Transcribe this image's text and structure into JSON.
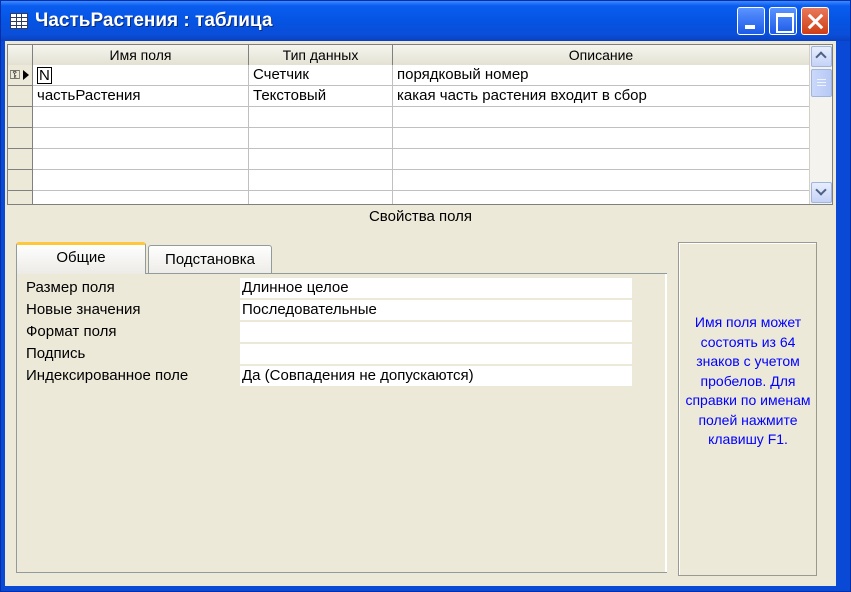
{
  "window": {
    "title": "ЧастьРастения : таблица"
  },
  "grid": {
    "columns": [
      "Имя поля",
      "Тип данных",
      "Описание"
    ],
    "rows": [
      {
        "name": "N",
        "type": "Счетчик",
        "description": "порядковый номер",
        "is_key": true,
        "current": true
      },
      {
        "name": "частьРастения",
        "type": "Текстовый",
        "description": "какая часть растения входит в сбор",
        "is_key": false,
        "current": false
      }
    ]
  },
  "properties": {
    "caption": "Свойства поля",
    "tabs": [
      "Общие",
      "Подстановка"
    ],
    "active_tab": "Общие",
    "items": [
      {
        "label": "Размер поля",
        "value": "Длинное целое"
      },
      {
        "label": "Новые значения",
        "value": "Последовательные"
      },
      {
        "label": "Формат поля",
        "value": ""
      },
      {
        "label": "Подпись",
        "value": ""
      },
      {
        "label": "Индексированное поле",
        "value": "Да (Совпадения не допускаются)"
      }
    ],
    "hint": "Имя поля может состоять из 64 знаков с учетом пробелов.  Для справки по именам полей нажмите клавишу F1."
  },
  "colors": {
    "title_bar": "#0554e3",
    "hint_text": "#0000ff"
  }
}
